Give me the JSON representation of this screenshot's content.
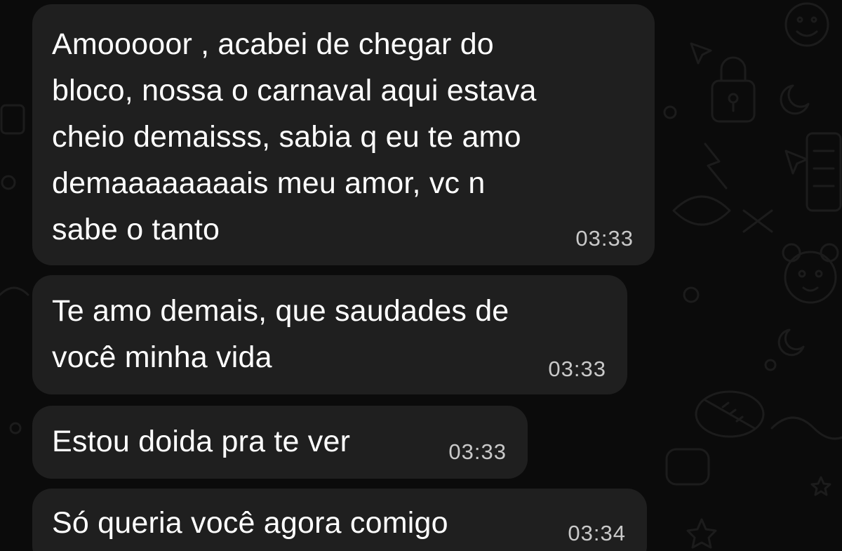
{
  "chat": {
    "wallpaper": {
      "color": "#0b0b0b",
      "doodle_color": "#1c1c1c",
      "icons": [
        "lock-icon",
        "lightning-icon",
        "cursor-icon",
        "moon-icon",
        "smiley-icon",
        "ball-icon",
        "bear-icon",
        "calculator-icon",
        "star-icon"
      ]
    },
    "bubble_color": "#1f1f1f",
    "messages": [
      {
        "text": "Amooooor , acabei de chegar do\nbloco, nossa o carnaval aqui estava\ncheio demaisss, sabia q eu te amo\ndemaaaaaaaais meu amor, vc n\nsabe o tanto",
        "time": "03:33"
      },
      {
        "text": "Te amo demais, que saudades de\nvocê minha vida",
        "time": "03:33"
      },
      {
        "text": "Estou doida pra te ver",
        "time": "03:33"
      },
      {
        "text": "Só queria você agora comigo",
        "time": "03:34"
      }
    ]
  }
}
